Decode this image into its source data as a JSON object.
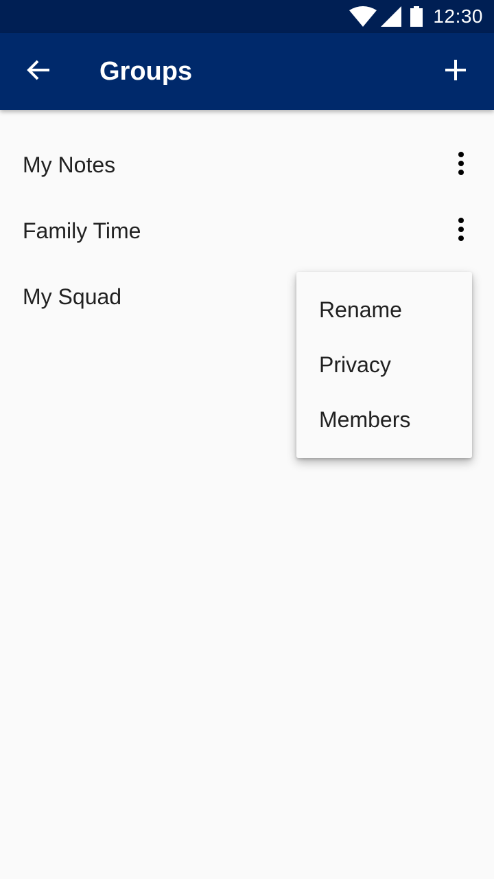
{
  "status_bar": {
    "time": "12:30",
    "icons": [
      "wifi-icon",
      "cell-signal-icon",
      "battery-icon"
    ],
    "background": "#001f54"
  },
  "app_bar": {
    "title": "Groups",
    "back_icon": "arrow-back-icon",
    "add_icon": "plus-icon",
    "background": "#00296b"
  },
  "groups": [
    {
      "label": "My Notes"
    },
    {
      "label": "Family Time"
    },
    {
      "label": "My Squad"
    }
  ],
  "menu": {
    "items": [
      {
        "label": "Rename"
      },
      {
        "label": "Privacy"
      },
      {
        "label": "Members"
      }
    ]
  }
}
